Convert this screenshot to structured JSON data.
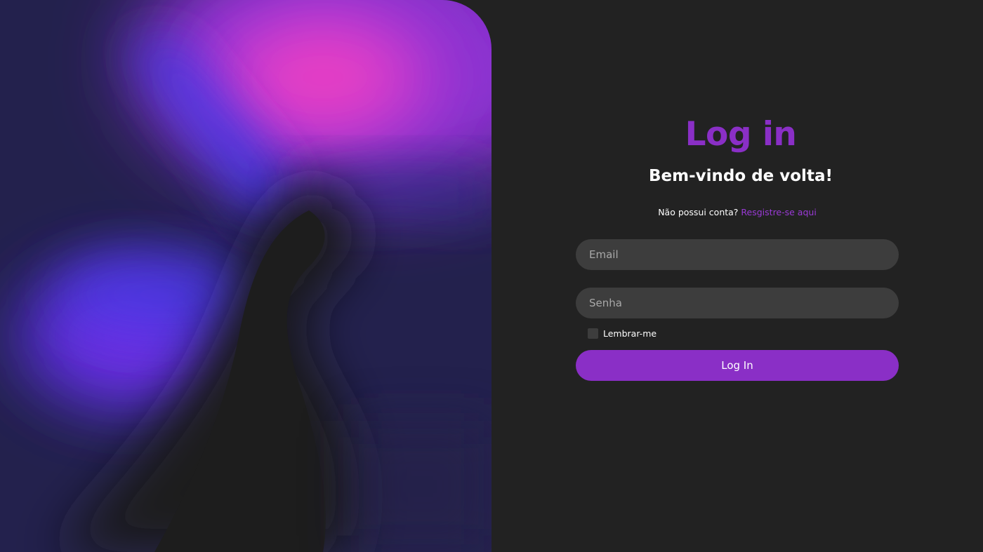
{
  "art": {
    "colors": {
      "base": "#22204a",
      "pink": "#f23dbd",
      "violet": "#9733d4",
      "blue": "#3e3aea",
      "purple_glow": "#6a2ee0",
      "shadow": "#1f1f1f"
    }
  },
  "login": {
    "title": "Log in",
    "subtitle": "Bem-vindo de volta!",
    "register_prompt": "Não possui conta?",
    "register_link": "Resgistre-se aqui",
    "email_placeholder": "Email",
    "email_value": "",
    "password_placeholder": "Senha",
    "password_value": "",
    "remember_label": "Lembrar-me",
    "remember_checked": false,
    "submit_label": "Log In"
  },
  "theme": {
    "background": "#222222",
    "accent": "#8a2fc6",
    "field_background": "#3d3d3d",
    "text": "#ffffff"
  }
}
